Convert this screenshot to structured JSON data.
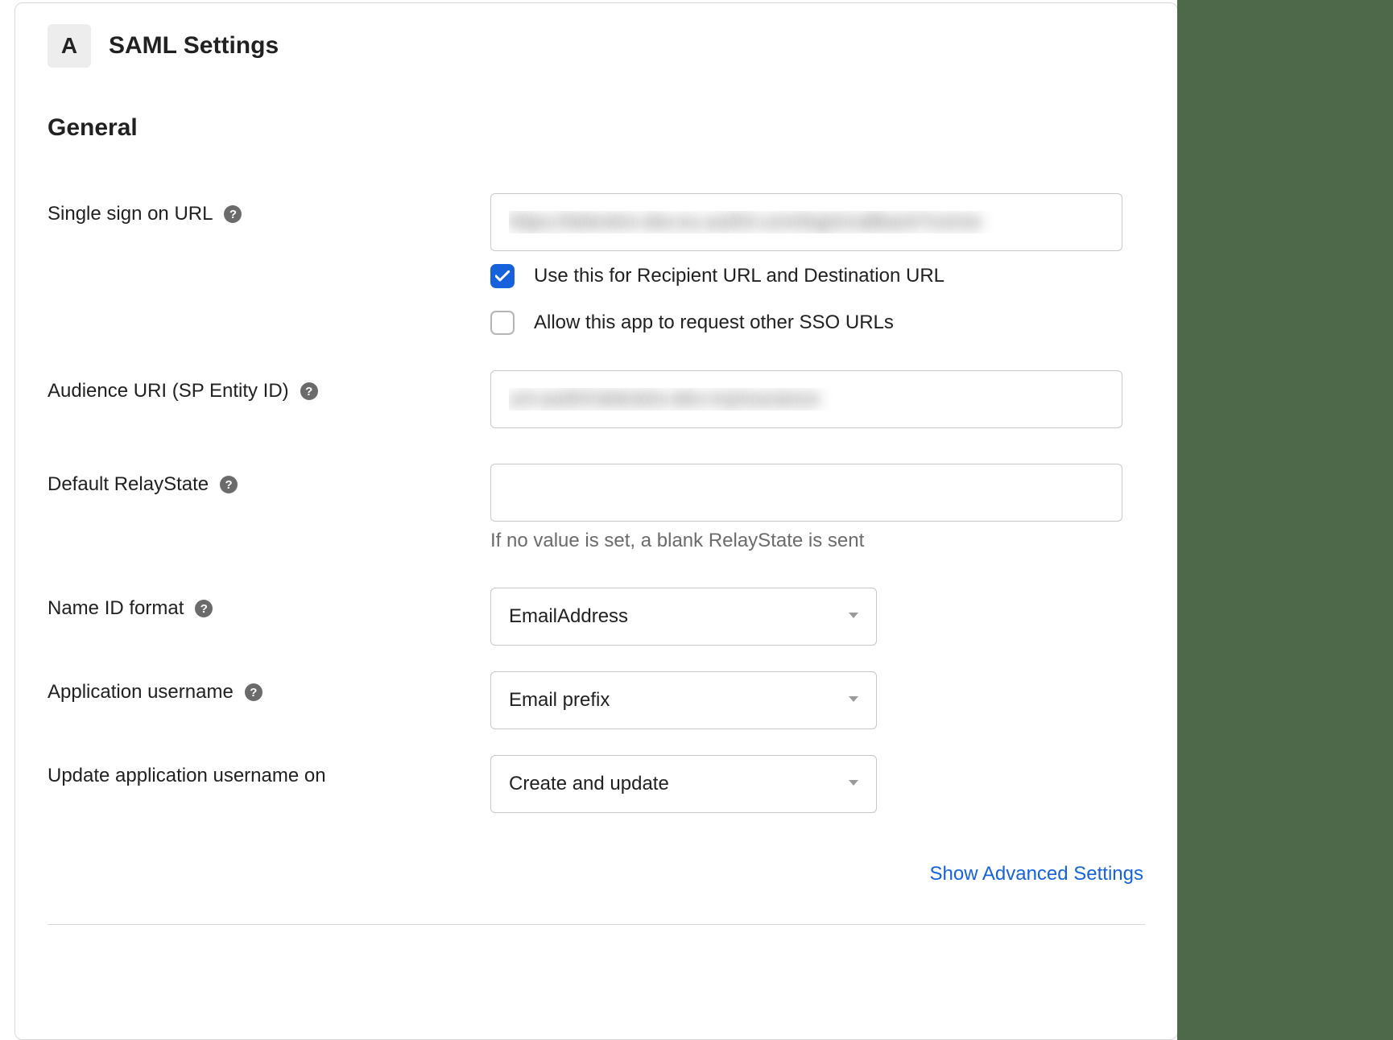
{
  "header": {
    "badge": "A",
    "title": "SAML Settings"
  },
  "section_title": "General",
  "fields": {
    "sso_url": {
      "label": "Single sign on URL",
      "value": "https://teleretro-dev.eu.auth0.com/login/callback?conne",
      "cb1_label": "Use this for Recipient URL and Destination URL",
      "cb1_checked": true,
      "cb2_label": "Allow this app to request other SSO URLs",
      "cb2_checked": false
    },
    "audience_uri": {
      "label": "Audience URI (SP Entity ID)",
      "value": "urn:auth0:teleretro-dev:myinsurance"
    },
    "relay_state": {
      "label": "Default RelayState",
      "value": "",
      "hint": "If no value is set, a blank RelayState is sent"
    },
    "name_id": {
      "label": "Name ID format",
      "value": "EmailAddress"
    },
    "app_username": {
      "label": "Application username",
      "value": "Email prefix"
    },
    "update_on": {
      "label": "Update application username on",
      "value": "Create and update"
    }
  },
  "advanced_link": "Show Advanced Settings"
}
